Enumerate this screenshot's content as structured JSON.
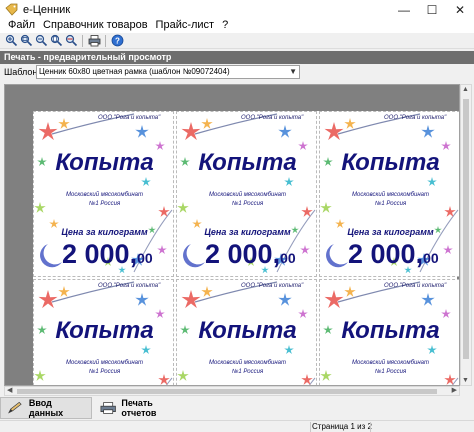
{
  "window": {
    "title": "е-Ценник",
    "controls": {
      "minimize": "—",
      "maximize": "☐",
      "close": "✕"
    }
  },
  "menu": [
    "Файл",
    "Справочник товаров",
    "Прайс-лист",
    "?"
  ],
  "toolbar": {
    "icons": [
      "zoom-in-icon",
      "zoom-fit-icon",
      "zoom-out-icon",
      "zoom-page-icon",
      "zoom-width-icon",
      "printer-icon",
      "help-icon"
    ]
  },
  "section": {
    "title": "Печать - предварительный просмотр"
  },
  "template": {
    "label": "Шаблон",
    "value": "Ценник 60х80 цветная рамка (шаблон №09072404)"
  },
  "price_tag": {
    "company": "ООО \"Рога и копыта\"",
    "product": "Копыта",
    "maker_line1": "Московский мясокомбинат",
    "maker_line2": "№1 Россия",
    "unit_label": "Цена за килограмм",
    "price_main": "2 000,",
    "price_cents": "00"
  },
  "buttons": {
    "data_input": "Ввод данных",
    "print_reports": "Печать отчетов"
  },
  "status": {
    "page": "Страница 1 из 2"
  },
  "colors": {
    "text_blue": "#13137a",
    "header_gray": "#6e6e6e",
    "preview_bg": "#808080"
  }
}
